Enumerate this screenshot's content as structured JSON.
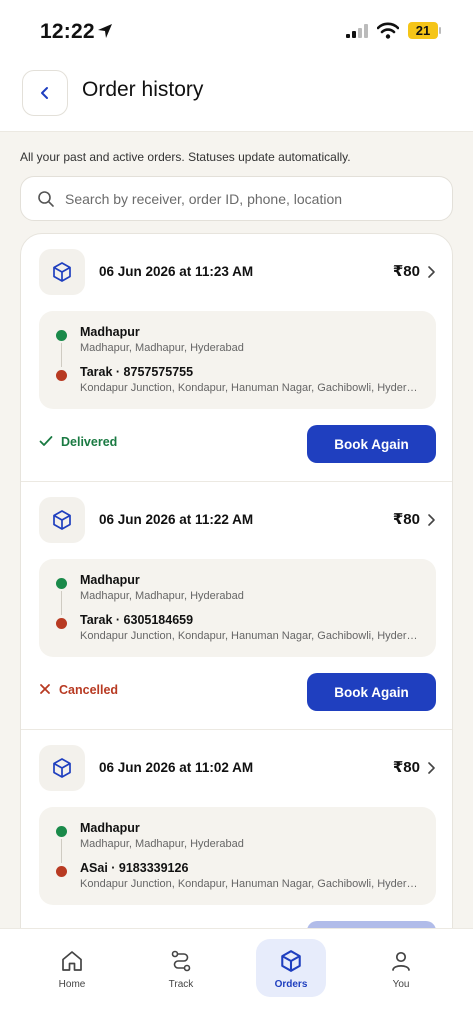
{
  "status_bar": {
    "time": "12:22",
    "battery": "21"
  },
  "header": {
    "title": "Order history"
  },
  "subtitle": "All your past and active orders. Statuses update automatically.",
  "search": {
    "placeholder": "Search by receiver, order ID, phone, location"
  },
  "orders": [
    {
      "datetime": "06 Jun 2026 at 11:23 AM",
      "price": "₹80",
      "pickup_name": "Madhapur",
      "pickup_address": "Madhapur, Madhapur, Hyderabad",
      "drop_name": "Tarak · 8757575755",
      "drop_address": "Kondapur Junction, Kondapur, Hanuman Nagar, Gachibowli, Hyderabad",
      "status": "Delivered",
      "action": "Book Again"
    },
    {
      "datetime": "06 Jun 2026 at 11:22 AM",
      "price": "₹80",
      "pickup_name": "Madhapur",
      "pickup_address": "Madhapur, Madhapur, Hyderabad",
      "drop_name": "Tarak · 6305184659",
      "drop_address": "Kondapur Junction, Kondapur, Hanuman Nagar, Gachibowli, Hyderabad",
      "status": "Cancelled",
      "action": "Book Again"
    },
    {
      "datetime": "06 Jun 2026 at 11:02 AM",
      "price": "₹80",
      "pickup_name": "Madhapur",
      "pickup_address": "Madhapur, Madhapur, Hyderabad",
      "drop_name": "ASai · 9183339126",
      "drop_address": "Kondapur Junction, Kondapur, Hanuman Nagar, Gachibowli, Hyderabad"
    }
  ],
  "tabs": [
    {
      "label": "Home",
      "icon": "home-icon"
    },
    {
      "label": "Track",
      "icon": "route-icon"
    },
    {
      "label": "Orders",
      "icon": "package-icon",
      "active": true
    },
    {
      "label": "You",
      "icon": "user-icon"
    }
  ],
  "colors": {
    "primary": "#1f3fbf",
    "delivered": "#1a7a42",
    "cancelled": "#b83a22",
    "pickup_dot": "#1a8a4a",
    "drop_dot": "#b83a22",
    "background": "#f6f4ef"
  }
}
